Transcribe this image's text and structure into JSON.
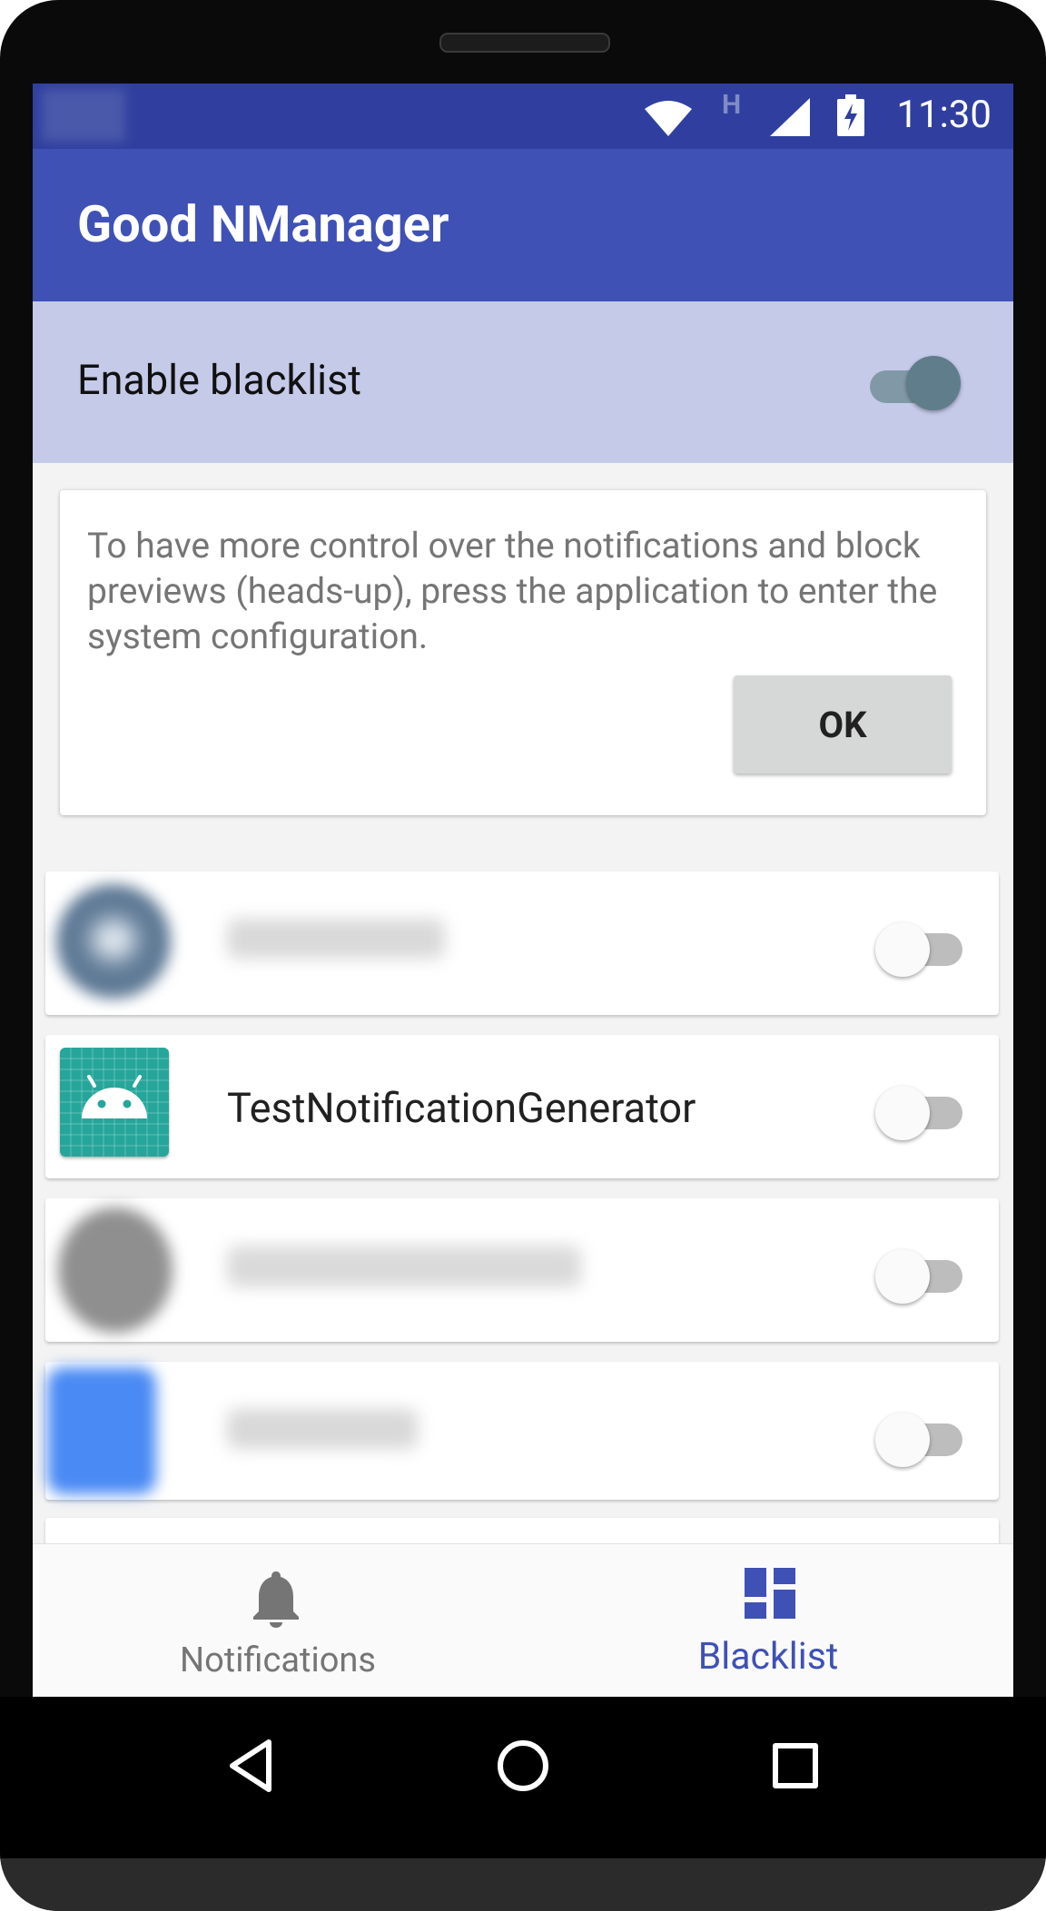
{
  "status_bar": {
    "time": "11:30",
    "network_type": "H",
    "icons": [
      "wifi-icon",
      "cell-signal-icon",
      "battery-charging-icon"
    ]
  },
  "app_bar": {
    "title": "Good NManager"
  },
  "blacklist_toggle": {
    "label": "Enable blacklist",
    "checked": true
  },
  "info_card": {
    "message": "To have more control over the notifications and block previews (heads-up), press the application to enter the system configuration.",
    "ok_label": "OK"
  },
  "apps": [
    {
      "label": "",
      "blurred": true,
      "enabled": false
    },
    {
      "label": "TestNotificationGenerator",
      "blurred": false,
      "enabled": false
    },
    {
      "label": "",
      "blurred": true,
      "enabled": false
    },
    {
      "label": "",
      "blurred": true,
      "enabled": false
    }
  ],
  "bottom_nav": {
    "items": [
      {
        "label": "Notifications",
        "icon": "bell-icon",
        "active": false
      },
      {
        "label": "Blacklist",
        "icon": "dashboard-icon",
        "active": true
      }
    ]
  },
  "system_nav": {
    "icons": [
      "back-icon",
      "home-icon",
      "recents-icon"
    ]
  },
  "colors": {
    "primary": "#3f51b5",
    "primary_dark": "#303f9f",
    "primary_light": "#c5cae9",
    "switch_on": "#607d8b",
    "android_icon": "#26a69a"
  }
}
